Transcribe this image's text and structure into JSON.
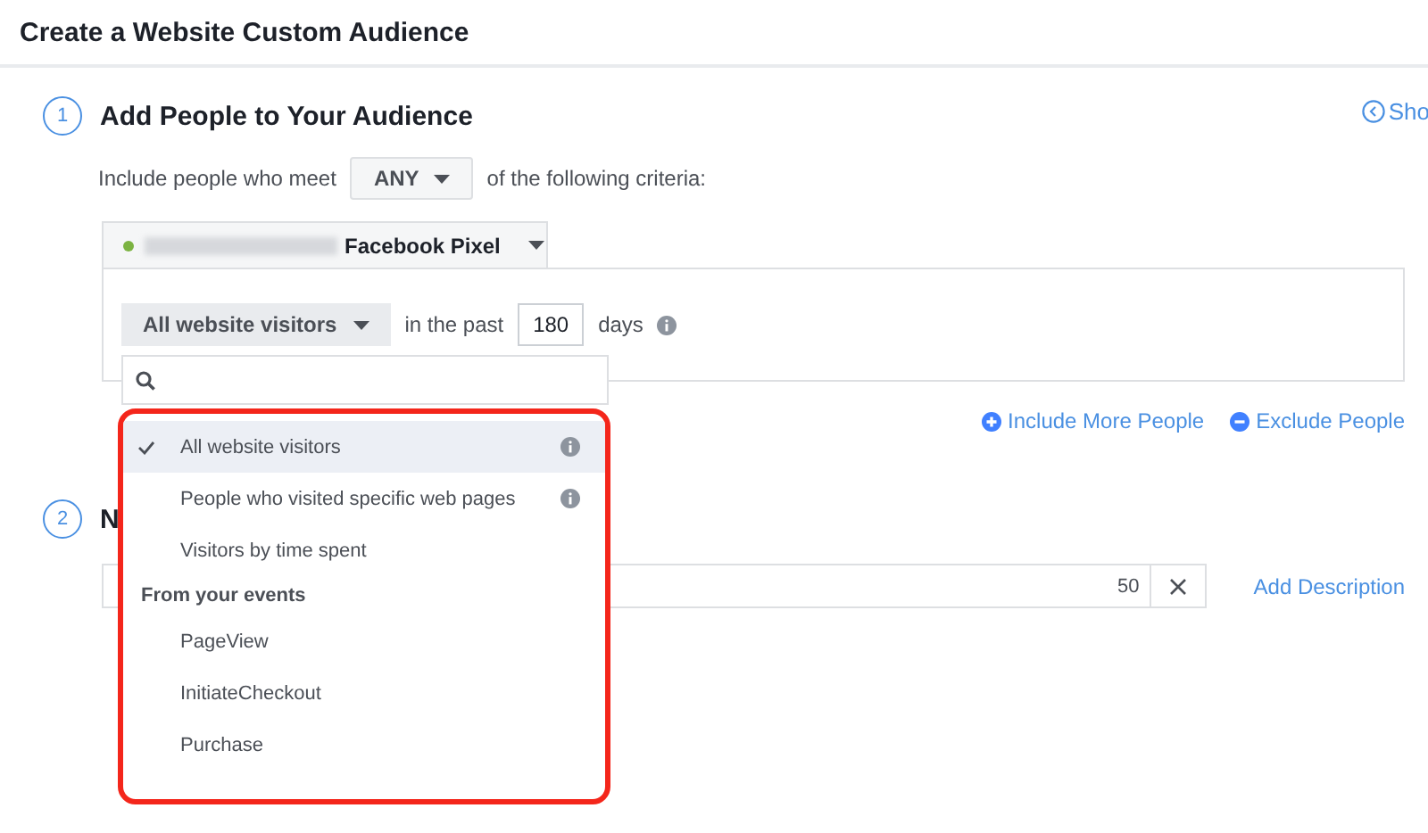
{
  "header": {
    "title": "Create a Website Custom Audience"
  },
  "side_link": {
    "label": "Sho"
  },
  "step1": {
    "number": "1",
    "title": "Add People to Your Audience",
    "criteria": {
      "prefix": "Include people who meet",
      "match": "ANY",
      "suffix": "of the following criteria:"
    },
    "pixel": {
      "active": true,
      "label": "Facebook Pixel"
    },
    "rule": {
      "audience": "All website visitors",
      "past_label": "in the past",
      "days": "180",
      "days_label": "days"
    },
    "links": [
      {
        "kind": "include",
        "label": "Include More People"
      },
      {
        "kind": "exclude",
        "label": "Exclude People"
      }
    ]
  },
  "step2": {
    "number": "2",
    "title": "N",
    "name_field": {
      "counter": "50"
    },
    "add_description": "Add Description"
  },
  "dropdown": {
    "items": [
      {
        "kind": "option",
        "label": "All website visitors",
        "selected": true,
        "info": true
      },
      {
        "kind": "option",
        "label": "People who visited specific web pages",
        "selected": false,
        "info": true
      },
      {
        "kind": "option",
        "label": "Visitors by time spent",
        "selected": false,
        "info": false
      },
      {
        "kind": "header",
        "label": "From your events"
      },
      {
        "kind": "option",
        "label": "PageView",
        "selected": false,
        "info": false
      },
      {
        "kind": "option",
        "label": "InitiateCheckout",
        "selected": false,
        "info": false
      },
      {
        "kind": "option",
        "label": "Purchase",
        "selected": false,
        "info": false
      }
    ]
  }
}
